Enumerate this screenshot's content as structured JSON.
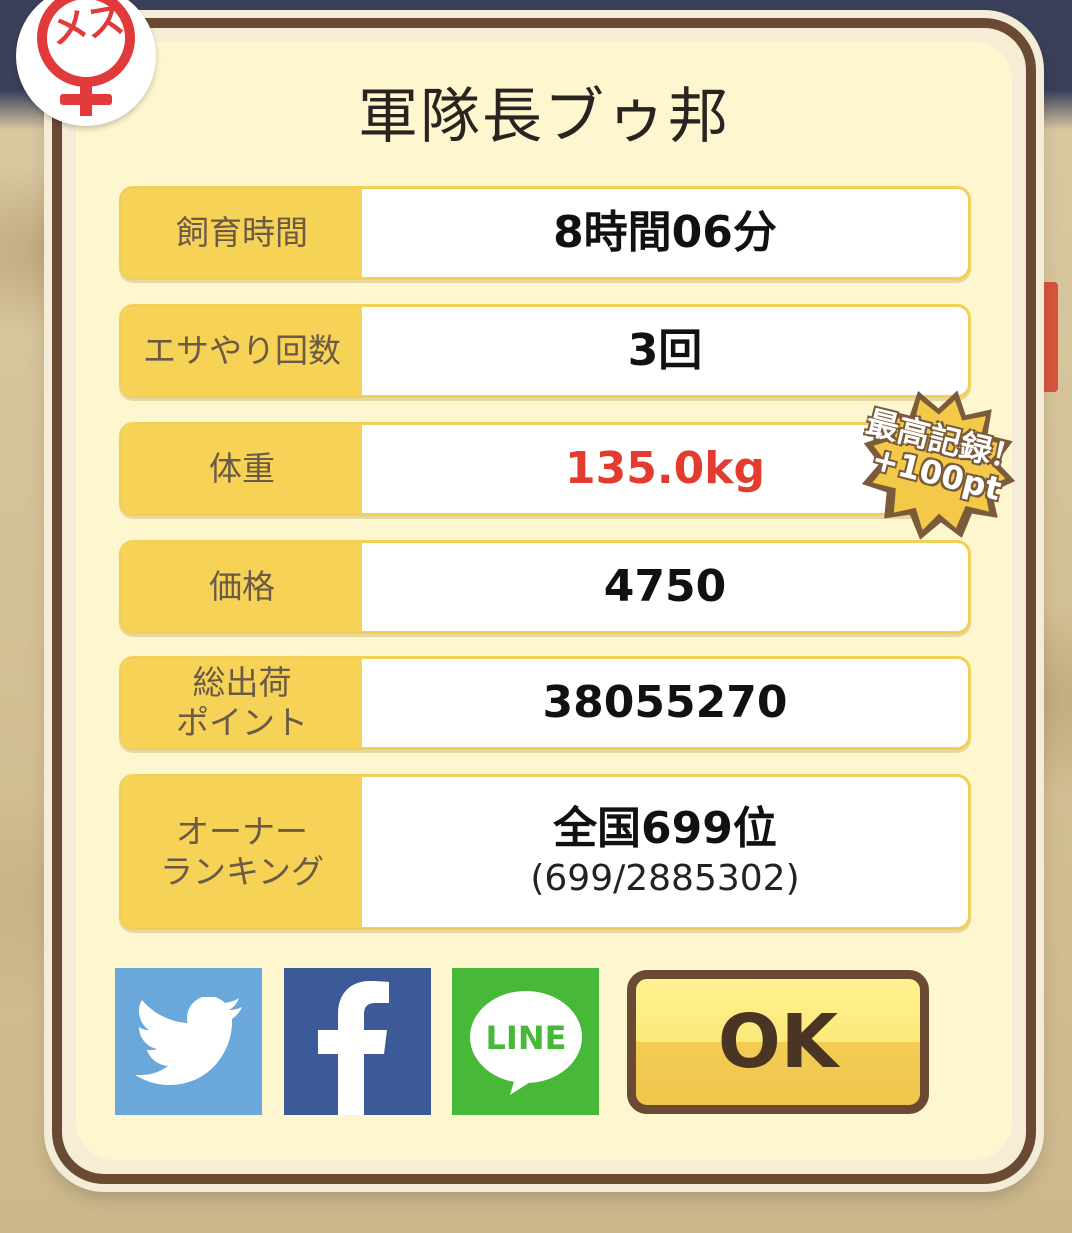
{
  "title": "軍隊長ブゥ邦",
  "gender": {
    "label": "メス",
    "icon": "female-symbol-icon",
    "color": "#e03a3a"
  },
  "stats": [
    {
      "label": "飼育時間",
      "value": "8時間06分"
    },
    {
      "label": "エサやり回数",
      "value": "3回"
    },
    {
      "label": "体重",
      "value": "135.0kg",
      "highlight_color": "#e33b2e"
    },
    {
      "label": "価格",
      "value": "4750"
    },
    {
      "label": "総出荷\nポイント",
      "value": "38055270"
    },
    {
      "label": "オーナー\nランキング",
      "value": "全国699位",
      "sub": "(699/2885302)"
    }
  ],
  "badge": {
    "line1": "最高記録！",
    "line2": "+100pt"
  },
  "share": {
    "twitter_icon": "twitter-bird-icon",
    "facebook_icon": "facebook-f-icon",
    "line_icon": "line-bubble-icon",
    "line_label": "LINE"
  },
  "ok_label": "OK"
}
